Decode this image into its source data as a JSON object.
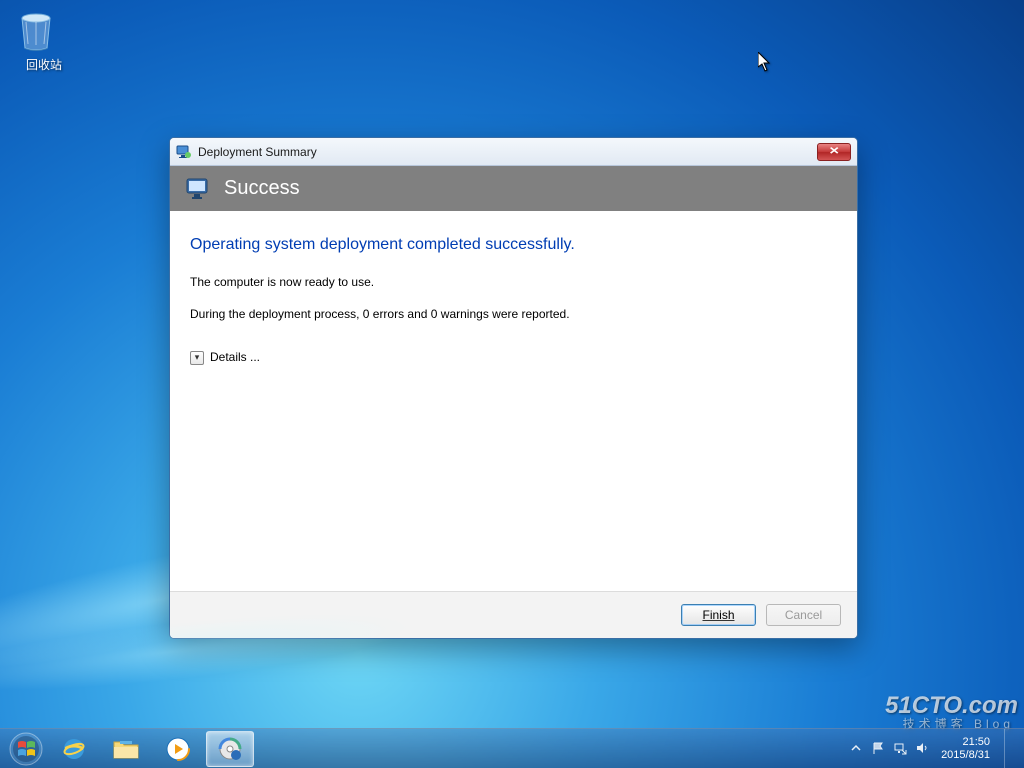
{
  "desktop": {
    "recycle_bin_label": "回收站"
  },
  "window": {
    "title": "Deployment Summary",
    "banner_title": "Success",
    "headline": "Operating system deployment completed successfully.",
    "ready_text": "The computer is now ready to use.",
    "report_text": "During the deployment process, 0 errors and 0 warnings were reported.",
    "details_label": "Details ...",
    "finish_label": "Finish",
    "cancel_label": "Cancel"
  },
  "tray": {
    "time": "21:50",
    "date": "2015/8/31"
  },
  "watermark": {
    "line1": "51CTO.com",
    "line2": "技术博客 Blog"
  }
}
